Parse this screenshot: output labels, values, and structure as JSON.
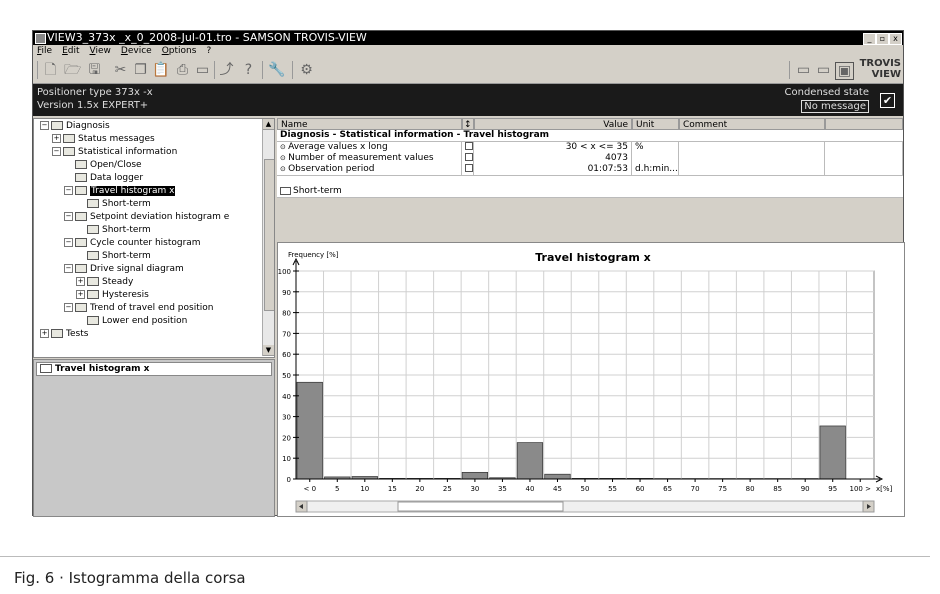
{
  "window": {
    "title": "VIEW3_373x _x_0_2008-Jul-01.tro - SAMSON TROVIS-VIEW",
    "controls": [
      "_",
      "▫",
      "x"
    ]
  },
  "menu": [
    "File",
    "Edit",
    "View",
    "Device",
    "Options",
    "?"
  ],
  "toolbar": {
    "left_icons": [
      "new-icon",
      "open-icon",
      "save-icon",
      "cut-icon",
      "copy-icon",
      "paste-icon",
      "print-icon",
      "preview-icon",
      "upload-icon",
      "help-icon",
      "wrench-icon",
      "settings-icon"
    ],
    "right_icons": [
      "device-read-icon",
      "device-write-icon",
      "monitor-icon"
    ],
    "logo": [
      "TROVIS",
      "VIEW"
    ]
  },
  "info": {
    "positioner": "Positioner type 373x -x",
    "version": "Version 1.5x EXPERT+",
    "condensed_state": "Condensed state",
    "message": "No message",
    "check": "✔"
  },
  "tree": {
    "items": [
      {
        "label": "Diagnosis",
        "level": 0,
        "exp": "−"
      },
      {
        "label": "Status messages",
        "level": 1,
        "exp": "+"
      },
      {
        "label": "Statistical information",
        "level": 1,
        "exp": "−"
      },
      {
        "label": "Open/Close",
        "level": 2,
        "exp": ""
      },
      {
        "label": "Data logger",
        "level": 2,
        "exp": ""
      },
      {
        "label": "Travel histogram x",
        "level": 2,
        "exp": "−",
        "selected": true
      },
      {
        "label": "Short-term",
        "level": 3,
        "exp": ""
      },
      {
        "label": "Setpoint deviation histogram e",
        "level": 2,
        "exp": "−"
      },
      {
        "label": "Short-term",
        "level": 3,
        "exp": ""
      },
      {
        "label": "Cycle counter histogram",
        "level": 2,
        "exp": "−"
      },
      {
        "label": "Short-term",
        "level": 3,
        "exp": ""
      },
      {
        "label": "Drive signal diagram",
        "level": 2,
        "exp": "−"
      },
      {
        "label": "Steady",
        "level": 3,
        "exp": "+"
      },
      {
        "label": "Hysteresis",
        "level": 3,
        "exp": "+"
      },
      {
        "label": "Trend of travel end position",
        "level": 2,
        "exp": "−"
      },
      {
        "label": "Lower end position",
        "level": 3,
        "exp": ""
      },
      {
        "label": "Tests",
        "level": 0,
        "exp": "+"
      }
    ]
  },
  "left_panel": {
    "header": "Travel histogram x"
  },
  "table": {
    "headers": {
      "name": "Name",
      "sort": "↕",
      "value": "Value",
      "unit": "Unit",
      "comment": "Comment"
    },
    "group": "Diagnosis - Statistical information - Travel histogram",
    "rows": [
      {
        "name": "Average values x long",
        "value": "30 < x  <= 35",
        "unit": "%"
      },
      {
        "name": "Number of measurement values",
        "value": "4073",
        "unit": ""
      },
      {
        "name": "Observation period",
        "value": "01:07:53",
        "unit": "d.h:min..."
      }
    ],
    "subgroup": "Short-term"
  },
  "chart_data": {
    "type": "bar",
    "title": "Travel histogram x",
    "ylabel": "Frequency [%]",
    "xlabel": "x[%]",
    "ylim": [
      0,
      100
    ],
    "yticks": [
      0,
      10,
      20,
      30,
      40,
      50,
      60,
      70,
      80,
      90,
      100
    ],
    "xticks": [
      "< 0",
      "5",
      "10",
      "15",
      "20",
      "25",
      "30",
      "35",
      "40",
      "45",
      "50",
      "55",
      "60",
      "65",
      "70",
      "75",
      "80",
      "85",
      "90",
      "95",
      "100 >"
    ],
    "values": [
      46.5,
      1,
      1.2,
      0.3,
      0.3,
      0.3,
      3.2,
      0.6,
      17.5,
      2.3,
      0.3,
      0.3,
      0.3,
      0.2,
      0.2,
      0.2,
      0.2,
      0.2,
      0.2,
      25.5,
      0
    ],
    "grid": true,
    "bar_color": "#8a8a8a"
  },
  "caption": "Fig. 6 · Istogramma della corsa"
}
